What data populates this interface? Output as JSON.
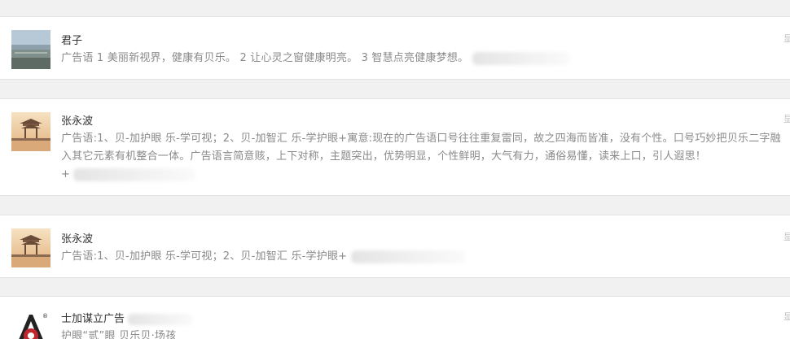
{
  "feed": {
    "items": [
      {
        "user": "君子",
        "avatar": "landscape-photo-avatar",
        "text": "广告语 1 美丽新视界，健康有贝乐。 2 让心灵之窗健康明亮。 3 智慧点亮健康梦想。",
        "trail": "显"
      },
      {
        "user": "张永波",
        "avatar": "pavilion-photo-avatar",
        "text": "广告语:1、贝-加护眼 乐-学可视；2、贝-加智汇 乐-学护眼+寓意:现在的广告语口号往往重复雷同，故之四海而皆准，没有个性。口号巧妙把贝乐二字融入其它元素有机整合一体。广告语言简意赅，上下对称，主题突出，优势明显，个性鲜明，大气有力，通俗易懂，读来上口，引人遐思！",
        "line3": "+",
        "trail": "显"
      },
      {
        "user": "张永波",
        "avatar": "pavilion-photo-avatar",
        "text": "广告语:1、贝-加护眼 乐-学可视；2、贝-加智汇 乐-学护眼+",
        "trail": "显"
      },
      {
        "user": "士加谋立广告",
        "avatar": "brand-logo-avatar",
        "text": "护眼“贰”眼 贝乐贝·场孩",
        "trail": "显"
      }
    ]
  },
  "colors": {
    "background": "#f1f1f1",
    "card": "#ffffff",
    "name": "#333333",
    "text": "#8a8a8a",
    "logo_red": "#c0262d"
  }
}
